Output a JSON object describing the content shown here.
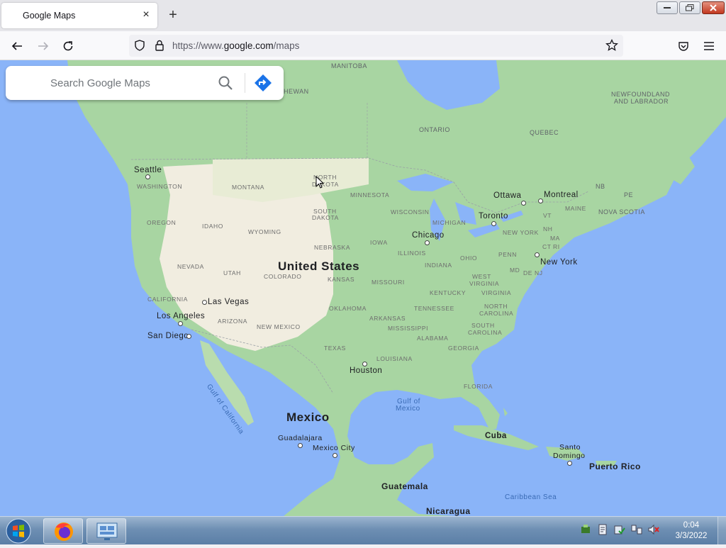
{
  "browser": {
    "tab_title": "Google Maps",
    "url_prefix": "https://www.",
    "url_host": "google.com",
    "url_path": "/maps"
  },
  "search": {
    "placeholder": "Search Google Maps"
  },
  "map": {
    "countries": {
      "us": "United States",
      "mexico": "Mexico",
      "cuba": "Cuba"
    },
    "provinces": {
      "manitoba": "MANITOBA",
      "saskatchewan": "HEWAN",
      "ontario": "ONTARIO",
      "quebec": "QUEBEC",
      "newfoundland_1": "NEWFOUNDLAND",
      "newfoundland_2": "AND LABRADOR",
      "nb": "NB",
      "pe": "PE",
      "nova_scotia": "NOVA SCOTIA"
    },
    "states": {
      "washington": "WASHINGTON",
      "montana": "MONTANA",
      "north_dakota_1": "NORTH",
      "north_dakota_2": "DAKOTA",
      "minnesota": "MINNESOTA",
      "oregon": "OREGON",
      "idaho": "IDAHO",
      "wyoming": "WYOMING",
      "south_dakota_1": "SOUTH",
      "south_dakota_2": "DAKOTA",
      "wisconsin": "WISCONSIN",
      "michigan": "MICHIGAN",
      "iowa": "IOWA",
      "nebraska": "NEBRASKA",
      "illinois": "ILLINOIS",
      "nevada": "NEVADA",
      "utah": "UTAH",
      "colorado": "COLORADO",
      "kansas": "KANSAS",
      "missouri": "MISSOURI",
      "indiana": "INDIANA",
      "ohio": "OHIO",
      "penn": "PENN",
      "new_york": "NEW YORK",
      "maine": "MAINE",
      "vt": "VT",
      "nh": "NH",
      "ma": "MA",
      "ct": "CT",
      "ri": "RI",
      "md": "MD",
      "de": "DE",
      "nj": "NJ",
      "west_virginia_1": "WEST",
      "west_virginia_2": "VIRGINIA",
      "virginia": "VIRGINIA",
      "kentucky": "KENTUCKY",
      "tennessee": "TENNESSEE",
      "north_carolina_1": "NORTH",
      "north_carolina_2": "CAROLINA",
      "south_carolina_1": "SOUTH",
      "south_carolina_2": "CAROLINA",
      "california": "CALIFORNIA",
      "arizona": "ARIZONA",
      "new_mexico": "NEW MEXICO",
      "oklahoma": "OKLAHOMA",
      "arkansas": "ARKANSAS",
      "mississippi": "MISSISSIPPI",
      "alabama": "ALABAMA",
      "georgia": "GEORGIA",
      "texas": "TEXAS",
      "louisiana": "LOUISIANA",
      "florida": "FLORIDA"
    },
    "cities": {
      "seattle": "Seattle",
      "ottawa": "Ottawa",
      "montreal": "Montreal",
      "toronto": "Toronto",
      "chicago": "Chicago",
      "new_york": "New York",
      "las_vegas": "Las Vegas",
      "los_angeles": "Los Angeles",
      "san_diego": "San Diego",
      "houston": "Houston",
      "guadalajara": "Guadalajara",
      "mexico_city": "Mexico City",
      "guatemala": "Guatemala",
      "nicaragua": "Nicaragua",
      "santo_domingo_1": "Santo",
      "santo_domingo_2": "Domingo",
      "puerto_rico": "Puerto Rico"
    },
    "water": {
      "gulf_california": "Gulf of California",
      "gulf_mexico_1": "Gulf of",
      "gulf_mexico_2": "Mexico",
      "caribbean": "Caribbean Sea"
    }
  },
  "taskbar": {
    "time": "0:04",
    "date": "3/3/2022"
  },
  "colors": {
    "water": "#8ab4f8",
    "land_green": "#a8d5a2",
    "land_tan": "#f1ede0",
    "directions_blue": "#1a73e8"
  }
}
